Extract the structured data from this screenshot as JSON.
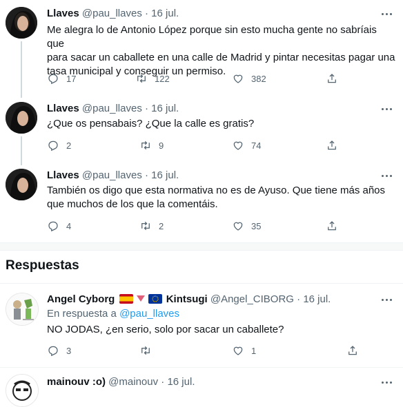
{
  "tweets": [
    {
      "name": "Llaves",
      "handle": "@pau_llaves",
      "sep": "·",
      "date": "16 jul.",
      "lines": [
        "Me alegra lo de Antonio López porque sin esto mucha gente no sabríais que",
        "para sacar un caballete en una calle de Madrid y pintar necesitas pagar una",
        "tasa municipal y conseguir un permiso."
      ],
      "replies": "17",
      "retweets": "122",
      "likes": "382"
    },
    {
      "name": "Llaves",
      "handle": "@pau_llaves",
      "sep": "·",
      "date": "16 jul.",
      "lines": [
        "¿Que os pensabais? ¿Que la calle es gratis?"
      ],
      "replies": "2",
      "retweets": "9",
      "likes": "74"
    },
    {
      "name": "Llaves",
      "handle": "@pau_llaves",
      "sep": "·",
      "date": "16 jul.",
      "lines": [
        "También os digo que esta normativa no es de Ayuso. Que tiene más años",
        "que muchos de los que la comentáis."
      ],
      "replies": "4",
      "retweets": "2",
      "likes": "35"
    }
  ],
  "section": {
    "title": "Respuestas"
  },
  "reply1": {
    "name_a": "Angel Cyborg",
    "name_b": "Kintsugi",
    "handle": "@Angel_CIBORG",
    "sep": "·",
    "date": "16 jul.",
    "reply_prefix": "En respuesta a",
    "reply_target": "@pau_llaves",
    "text": "NO JODAS, ¿en serio, solo por sacar un caballete?",
    "replies": "3",
    "retweets": "",
    "likes": "1"
  },
  "reply2": {
    "name": "mainouv :o)",
    "handle": "@mainouv",
    "sep": "·",
    "date": "16 jul."
  },
  "colors": {
    "accent": "#1d9bf0",
    "muted": "#536471",
    "text": "#0f1419",
    "line": "#cfd9de"
  },
  "icons": [
    "reply-icon",
    "retweet-icon",
    "like-icon",
    "share-icon",
    "more-icon"
  ]
}
